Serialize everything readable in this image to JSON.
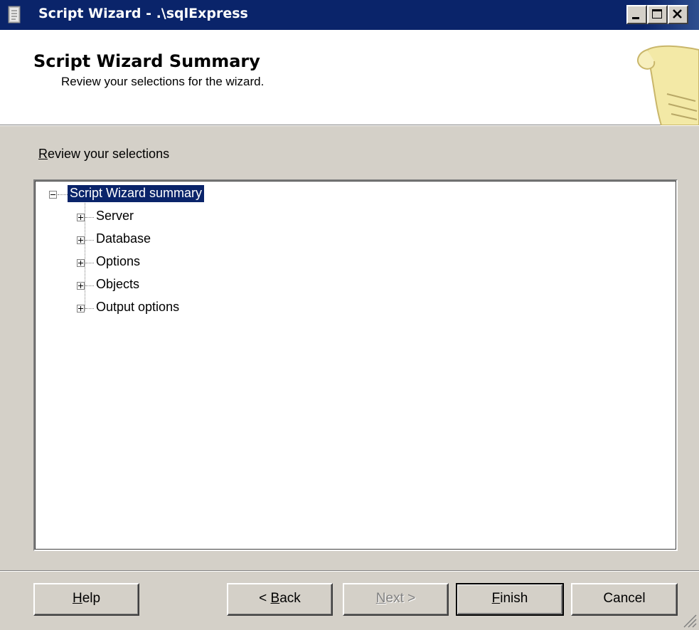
{
  "window": {
    "title": "Script Wizard - .\\sqlExpress"
  },
  "header": {
    "title": "Script Wizard Summary",
    "subtitle": "Review your selections for the wizard."
  },
  "review": {
    "label_prefix": "R",
    "label_rest": "eview your selections"
  },
  "tree": {
    "root": "Script Wizard summary",
    "children": [
      "Server",
      "Database",
      "Options",
      "Objects",
      "Output options"
    ]
  },
  "buttons": {
    "help_u": "H",
    "help_rest": "elp",
    "back_pre": "< ",
    "back_u": "B",
    "back_rest": "ack",
    "next_u": "N",
    "next_rest": "ext >",
    "finish_u": "F",
    "finish_rest": "inish",
    "cancel": "Cancel"
  },
  "colors": {
    "titlebar": "#0a246a",
    "selection": "#0a246a",
    "face": "#d4d0c8"
  },
  "icons": {
    "app": "document-icon",
    "banner": "scroll-icon"
  }
}
